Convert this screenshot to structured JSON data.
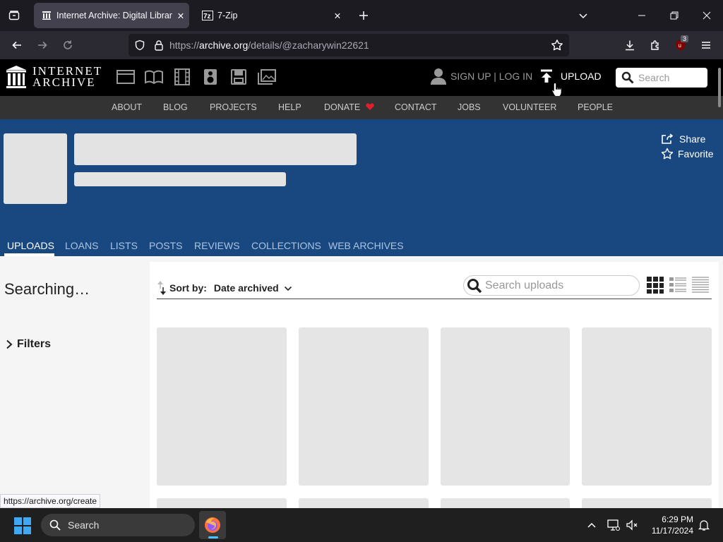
{
  "browser": {
    "tabs": [
      {
        "title": "Internet Archive: Digital Library",
        "active": true
      },
      {
        "title": "7-Zip",
        "active": false
      }
    ],
    "url_prefix": "https://",
    "url_domain": "archive.org",
    "url_path": "/details/@zacharywin22621",
    "extension_badge": "3",
    "status_url": "https://archive.org/create"
  },
  "ia_header": {
    "logo_line1": "INTERNET",
    "logo_line2": "ARCHIVE",
    "signup_login": "SIGN UP | LOG IN",
    "upload": "UPLOAD",
    "search_placeholder": "Search"
  },
  "ia_nav": [
    "ABOUT",
    "BLOG",
    "PROJECTS",
    "HELP",
    "DONATE",
    "CONTACT",
    "JOBS",
    "VOLUNTEER",
    "PEOPLE"
  ],
  "banner": {
    "share": "Share",
    "favorite": "Favorite"
  },
  "profile_tabs": [
    "UPLOADS",
    "LOANS",
    "LISTS",
    "POSTS",
    "REVIEWS",
    "COLLECTIONS",
    "WEB ARCHIVES"
  ],
  "content": {
    "status": "Searching…",
    "filters": "Filters",
    "sort_label": "Sort by:",
    "sort_value": "Date archived",
    "search_placeholder": "Search uploads"
  },
  "taskbar": {
    "search_placeholder": "Search",
    "time": "6:29 PM",
    "date": "11/17/2024"
  },
  "colors": {
    "banner": "#194880",
    "ia_header": "#000000",
    "ia_nav": "#333333"
  }
}
